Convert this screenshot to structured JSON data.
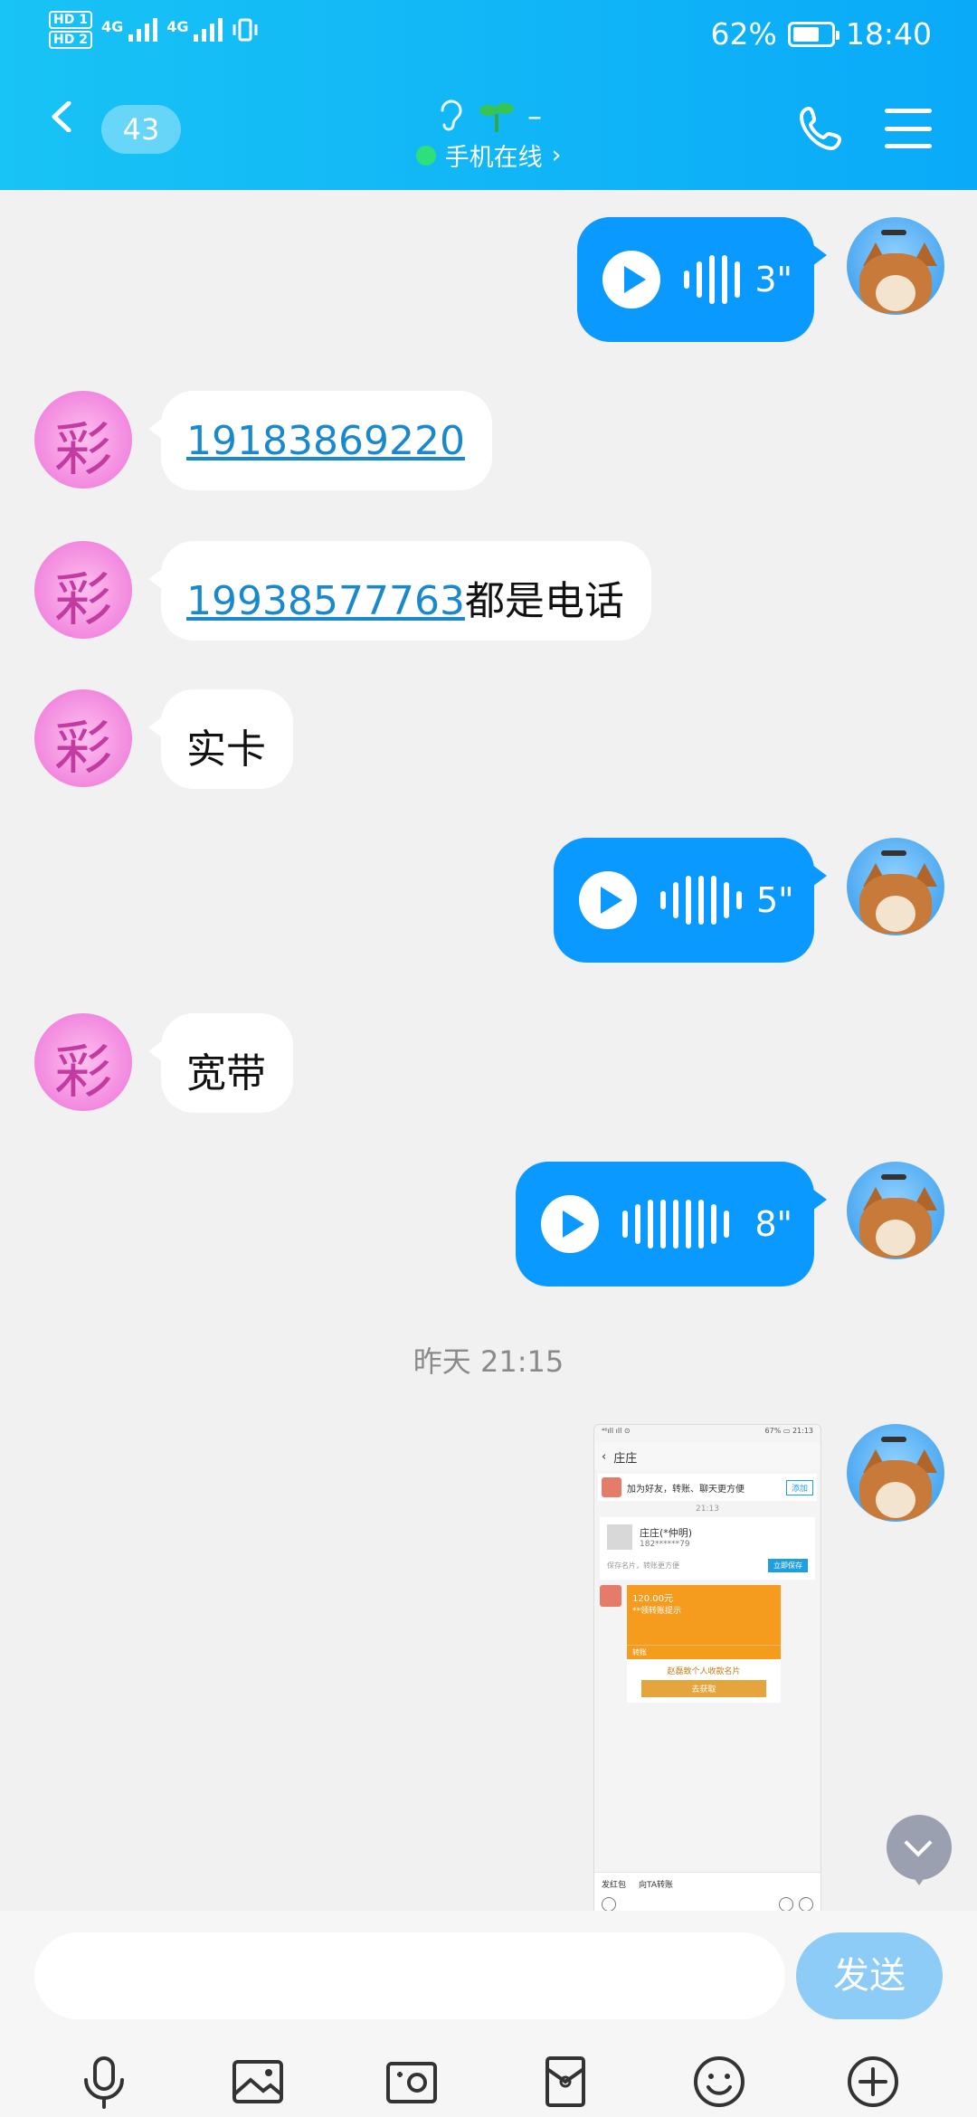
{
  "status_bar": {
    "hd1": "HD 1",
    "hd2": "HD 2",
    "net1": "4G",
    "net2": "4G",
    "battery": "62%",
    "time": "18:40"
  },
  "header": {
    "unread_count": "43",
    "title": "–",
    "subtitle": "手机在线",
    "subtitle_chevron": "›"
  },
  "messages": [
    {
      "side": "out",
      "type": "voice",
      "duration": "3\""
    },
    {
      "side": "in",
      "type": "text",
      "link": "19183869220",
      "text": ""
    },
    {
      "side": "in",
      "type": "text",
      "link": "19938577763",
      "text": "都是电话"
    },
    {
      "side": "in",
      "type": "text",
      "link": "",
      "text": "实卡"
    },
    {
      "side": "out",
      "type": "voice",
      "duration": "5\""
    },
    {
      "side": "in",
      "type": "text",
      "link": "",
      "text": "宽带"
    },
    {
      "side": "out",
      "type": "voice",
      "duration": "8\""
    }
  ],
  "timestamp": "昨天 21:15",
  "thumbnail": {
    "status_left": "⁴⁶ıll ıll ⊙",
    "status_right": "67% ▭ 21:13",
    "title": "庄庄",
    "banner_text": "加为好友，转账、聊天更方便",
    "banner_add": "添加",
    "time": "21:13",
    "contact_name": "庄庄(*仲明)",
    "contact_num": "182******79",
    "save_hint": "保存名片，转账更方便",
    "save_btn": "立即保存",
    "amount": "120.00元",
    "amount_sub": "**领转账提示",
    "transfer_label": "转账",
    "card_text": "赵磊致个人收款名片",
    "card_btn": "去获取",
    "foot1": "发红包",
    "foot2": "向TA转账"
  },
  "input": {
    "placeholder": "",
    "send_label": "发送"
  },
  "toolbar": [
    "mic-icon",
    "image-icon",
    "camera-icon",
    "red-packet-icon",
    "emoji-icon",
    "plus-icon"
  ]
}
